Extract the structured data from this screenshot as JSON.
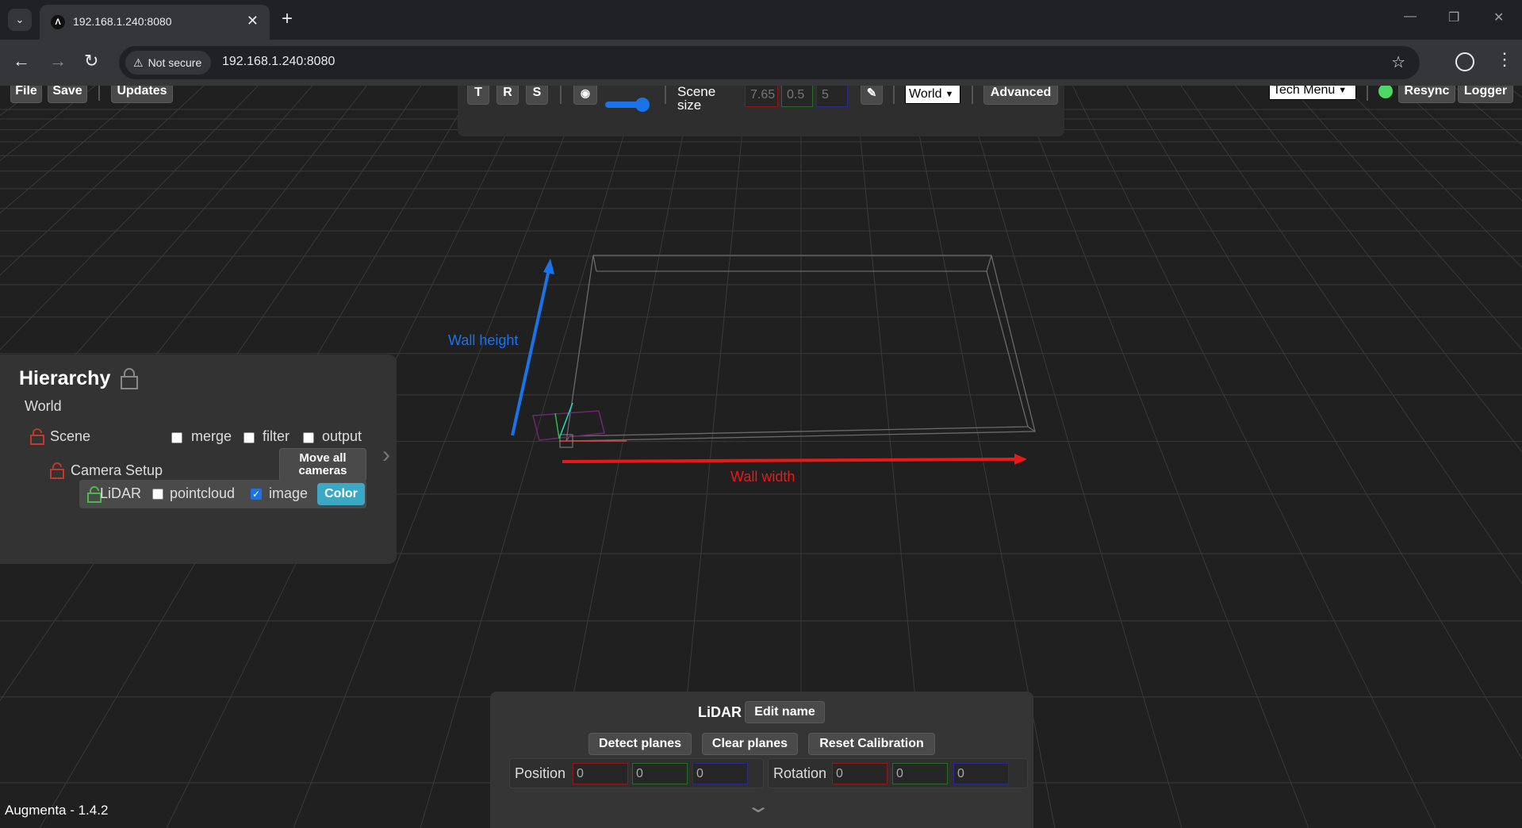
{
  "browser": {
    "tab_title": "192.168.1.240:8080",
    "favicon_glyph": "Λ",
    "security_label": "Not secure",
    "url": "192.168.1.240:8080"
  },
  "toolbar": {
    "file": "File",
    "save": "Save",
    "updates": "Updates",
    "t": "T",
    "r": "R",
    "s": "S",
    "scene_size_label": "Scene size",
    "scene_size_x": "7.65",
    "scene_size_y": "0.5",
    "scene_size_z": "5",
    "space_select": "World",
    "advanced": "Advanced",
    "tech_menu": "Tech Menu",
    "resync": "Resync",
    "logger": "Logger",
    "status_color": "#4cd964"
  },
  "scene": {
    "wall_height_label": "Wall height",
    "wall_width_label": "Wall width",
    "height_color": "#1a73e8",
    "width_color": "#e81919"
  },
  "hierarchy": {
    "title": "Hierarchy",
    "world": "World",
    "scene": "Scene",
    "merge": "merge",
    "filter": "filter",
    "output": "output",
    "camera_setup": "Camera Setup",
    "move_all_cameras": "Move all cameras",
    "lidar": "LiDAR",
    "pointcloud": "pointcloud",
    "image": "image",
    "image_checked": true,
    "color_button": "Color"
  },
  "bottom_panel": {
    "title": "LiDAR",
    "edit_name": "Edit name",
    "detect_planes": "Detect planes",
    "clear_planes": "Clear planes",
    "reset_calibration": "Reset Calibration",
    "position_label": "Position",
    "position": [
      "0",
      "0",
      "0"
    ],
    "rotation_label": "Rotation",
    "rotation": [
      "0",
      "0",
      "0"
    ]
  },
  "footer": {
    "version": "Augmenta - 1.4.2"
  }
}
